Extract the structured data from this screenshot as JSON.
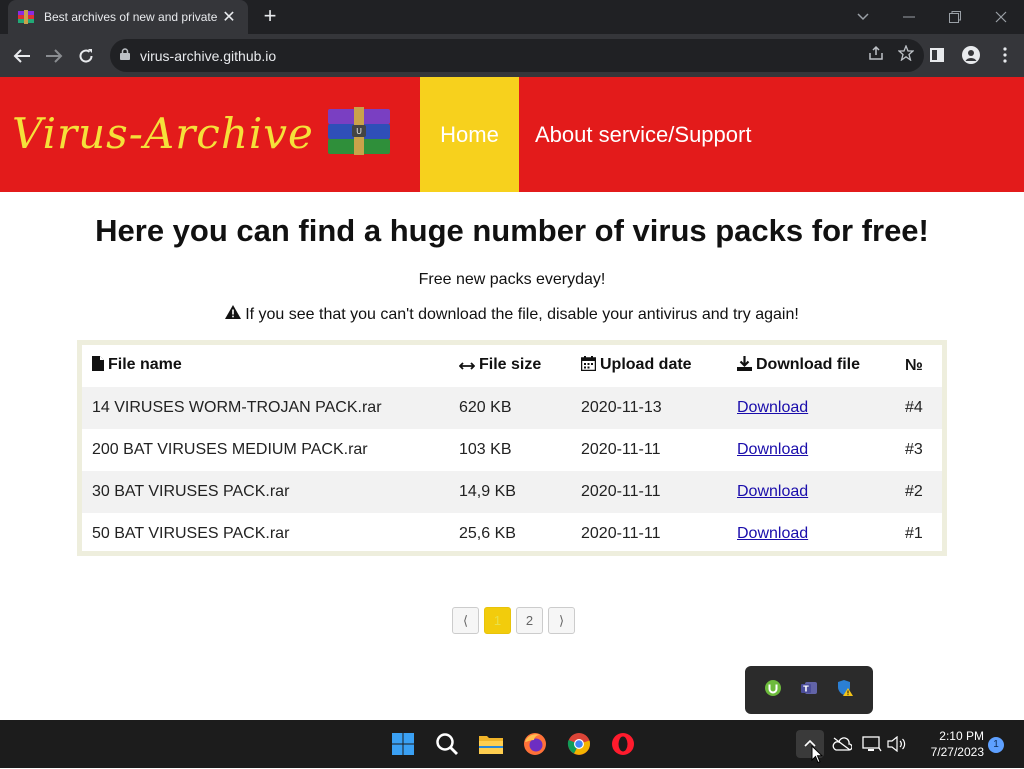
{
  "browser": {
    "tab_title": "Best archives of new and private",
    "url": "virus-archive.github.io"
  },
  "site": {
    "logo_text": "Virus-Archive",
    "nav": {
      "home": "Home",
      "about": "About service/Support"
    }
  },
  "content": {
    "headline": "Here you can find a huge number of virus packs for free!",
    "subline": "Free new packs everyday!",
    "warning": "If you see that you can't download the file, disable your antivirus and try again!"
  },
  "table": {
    "headers": [
      "File name",
      "File size",
      "Upload date",
      "Download file",
      "№"
    ],
    "rows": [
      {
        "name": "14 VIRUSES WORM-TROJAN PACK.rar",
        "size": "620 KB",
        "date": "2020-11-13",
        "link": "Download",
        "num": "#4"
      },
      {
        "name": "200 BAT VIRUSES MEDIUM PACK.rar",
        "size": "103 KB",
        "date": "2020-11-11",
        "link": "Download",
        "num": "#3"
      },
      {
        "name": "30 BAT VIRUSES PACK.rar",
        "size": "14,9 KB",
        "date": "2020-11-11",
        "link": "Download",
        "num": "#2"
      },
      {
        "name": "50 BAT VIRUSES PACK.rar",
        "size": "25,6 KB",
        "date": "2020-11-11",
        "link": "Download",
        "num": "#1"
      }
    ]
  },
  "pager": {
    "prev": "⟨",
    "pages": [
      "1",
      "2"
    ],
    "next": "⟩",
    "active": "1"
  },
  "taskbar": {
    "time": "2:10 PM",
    "date": "7/27/2023",
    "notification_count": "1"
  },
  "colors": {
    "header_red": "#e31b1b",
    "home_yellow": "#f7d11d",
    "logo_yellow": "#f5e13a",
    "link_blue": "#1a0dab"
  }
}
